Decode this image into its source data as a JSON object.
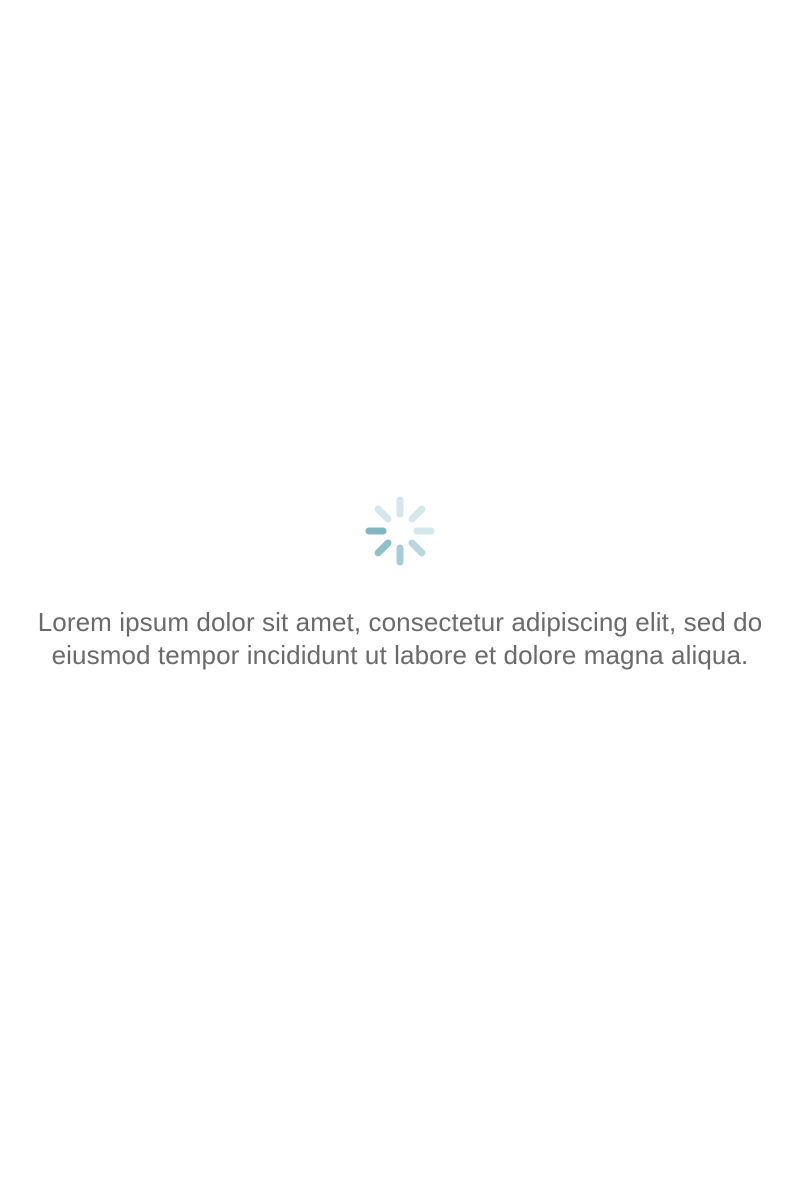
{
  "loading": {
    "message": "Lorem ipsum dolor sit amet, consectetur adipiscing elit, sed do eiusmod tempor incididunt ut labore et dolore magna aliqua.",
    "spinner_icon": "activity-spinner-icon",
    "spinner_color": "#7fb6bf"
  }
}
